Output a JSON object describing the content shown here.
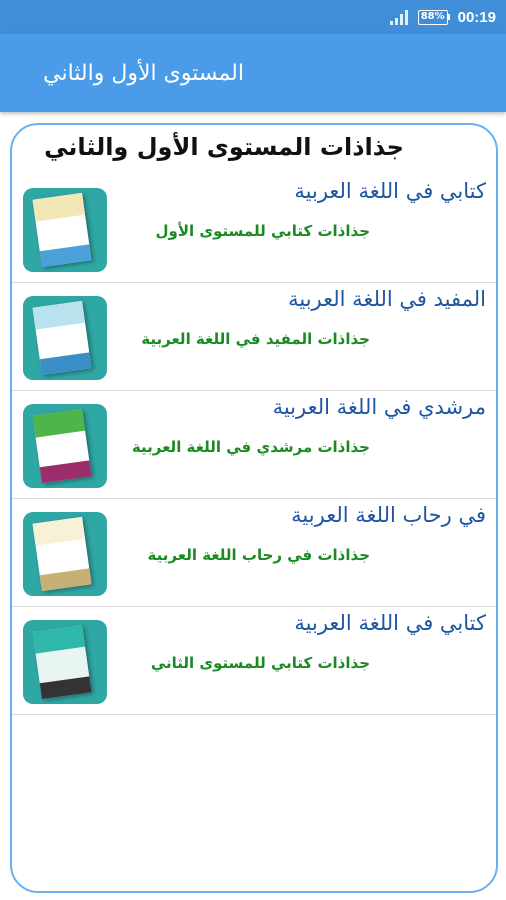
{
  "status_bar": {
    "battery": "88%",
    "time": "00:19"
  },
  "app_bar": {
    "title": "المستوى الأول والثاني"
  },
  "card": {
    "heading": "جذاذات المستوى الأول والثاني",
    "items": [
      {
        "title": "كتابي في اللغة العربية",
        "subtitle": "جذاذات كتابي للمستوى الأول",
        "cover_colors": [
          "#f3e7b8",
          "#ffffff",
          "#4aa0d8"
        ]
      },
      {
        "title": "المفيد في اللغة العربية",
        "subtitle": "جذاذات المفيد في اللغة العربية",
        "cover_colors": [
          "#b9e2ef",
          "#ffffff",
          "#3b8fc7"
        ]
      },
      {
        "title": "مرشدي في اللغة العربية",
        "subtitle": "جذاذات مرشدي في اللغة العربية",
        "cover_colors": [
          "#4fb44a",
          "#ffffff",
          "#9b2d6b"
        ]
      },
      {
        "title": "في رحاب اللغة العربية",
        "subtitle": "جذاذات في رحاب اللغة العربية",
        "cover_colors": [
          "#f7f1d8",
          "#ffffff",
          "#c8b074"
        ]
      },
      {
        "title": "كتابي في اللغة العربية",
        "subtitle": "جذاذات كتابي للمستوى الثاني",
        "cover_colors": [
          "#2fb7a9",
          "#e9f5f2",
          "#333333"
        ]
      }
    ]
  },
  "colors": {
    "status_bar": "#3f8ed7",
    "app_bar": "#4b9ce8",
    "card_border": "#68b0f0",
    "item_title": "#1f56a3",
    "item_subtitle": "#1a8a22"
  }
}
